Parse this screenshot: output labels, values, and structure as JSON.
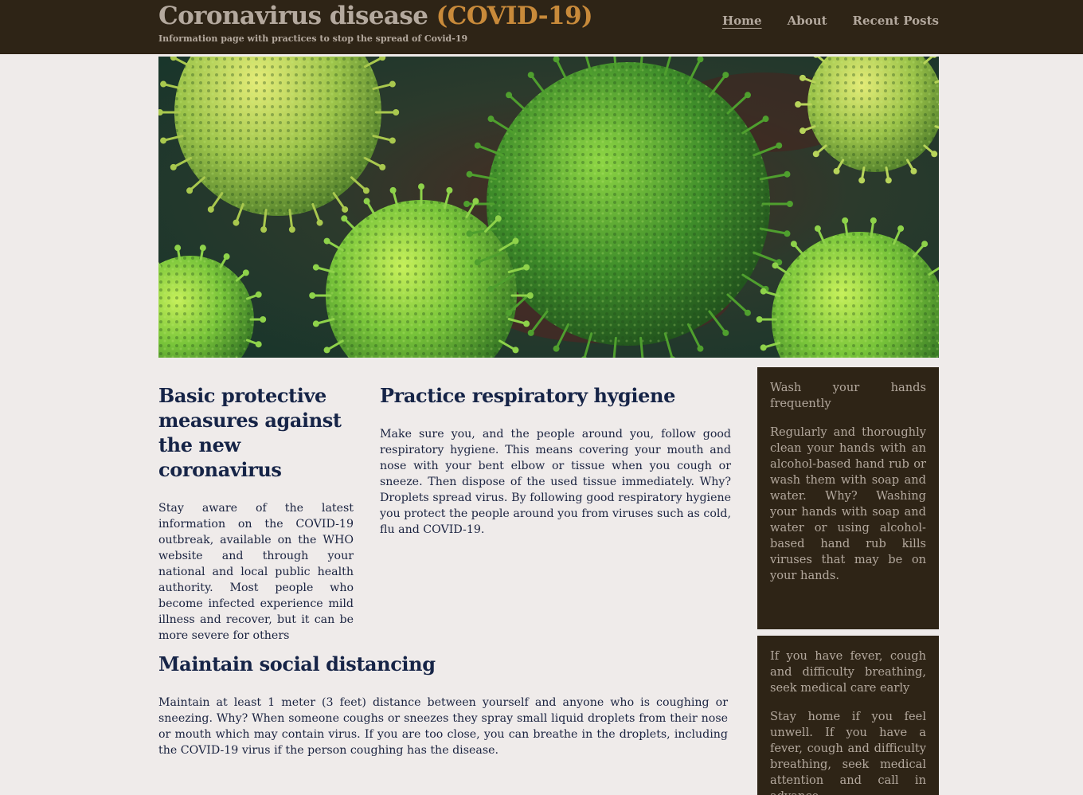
{
  "header": {
    "title_main": "Coronavirus disease ",
    "title_accent": "(COVID-19)",
    "tagline": "Information page with practices to stop the spread of Covid-19",
    "nav": [
      {
        "label": "Home",
        "active": true
      },
      {
        "label": "About",
        "active": false
      },
      {
        "label": "Recent Posts",
        "active": false
      }
    ]
  },
  "articles": {
    "basic": {
      "heading": "Basic protective measures against the new coronavirus",
      "body": "Stay aware of the latest information on the COVID-19 outbreak, available on the WHO website and through your national and local public health authority. Most people who become infected experience mild illness and recover, but it can be more severe for others"
    },
    "hygiene": {
      "heading": "Practice respiratory hygiene",
      "body": "Make sure you, and the people around you, follow good respiratory hygiene. This means covering your mouth and nose with your bent elbow or tissue when you cough or sneeze. Then dispose of the used tissue immediately. Why? Droplets spread virus. By following good respiratory hygiene you protect the people around you from viruses such as cold, flu and COVID-19."
    },
    "distancing": {
      "heading": "Maintain social distancing",
      "body": "Maintain at least 1 meter (3 feet) distance between yourself and anyone who is coughing or sneezing. Why? When someone coughs or sneezes they spray small liquid droplets from their nose or mouth which may contain virus. If you are too close, you can breathe in the droplets, including the COVID-19 virus if the person coughing has the disease."
    }
  },
  "sidebar": {
    "wash": {
      "title": "Wash your hands frequently",
      "body": "Regularly and thoroughly clean your hands with an alcohol-based hand rub or wash them with soap and water. Why? Washing your hands with soap and water or using alcohol-based hand rub kills viruses that may be on your hands."
    },
    "fever": {
      "title": "If you have fever, cough and difficulty breathing, seek medical care early",
      "body": "Stay home if you feel unwell. If you have a fever, cough and difficulty breathing, seek medical attention and call in advance."
    }
  },
  "colors": {
    "header_bg": "#2e2416",
    "page_bg": "#efebea",
    "accent": "#c88a3a",
    "heading": "#162447",
    "muted_text": "#b4a99e"
  }
}
